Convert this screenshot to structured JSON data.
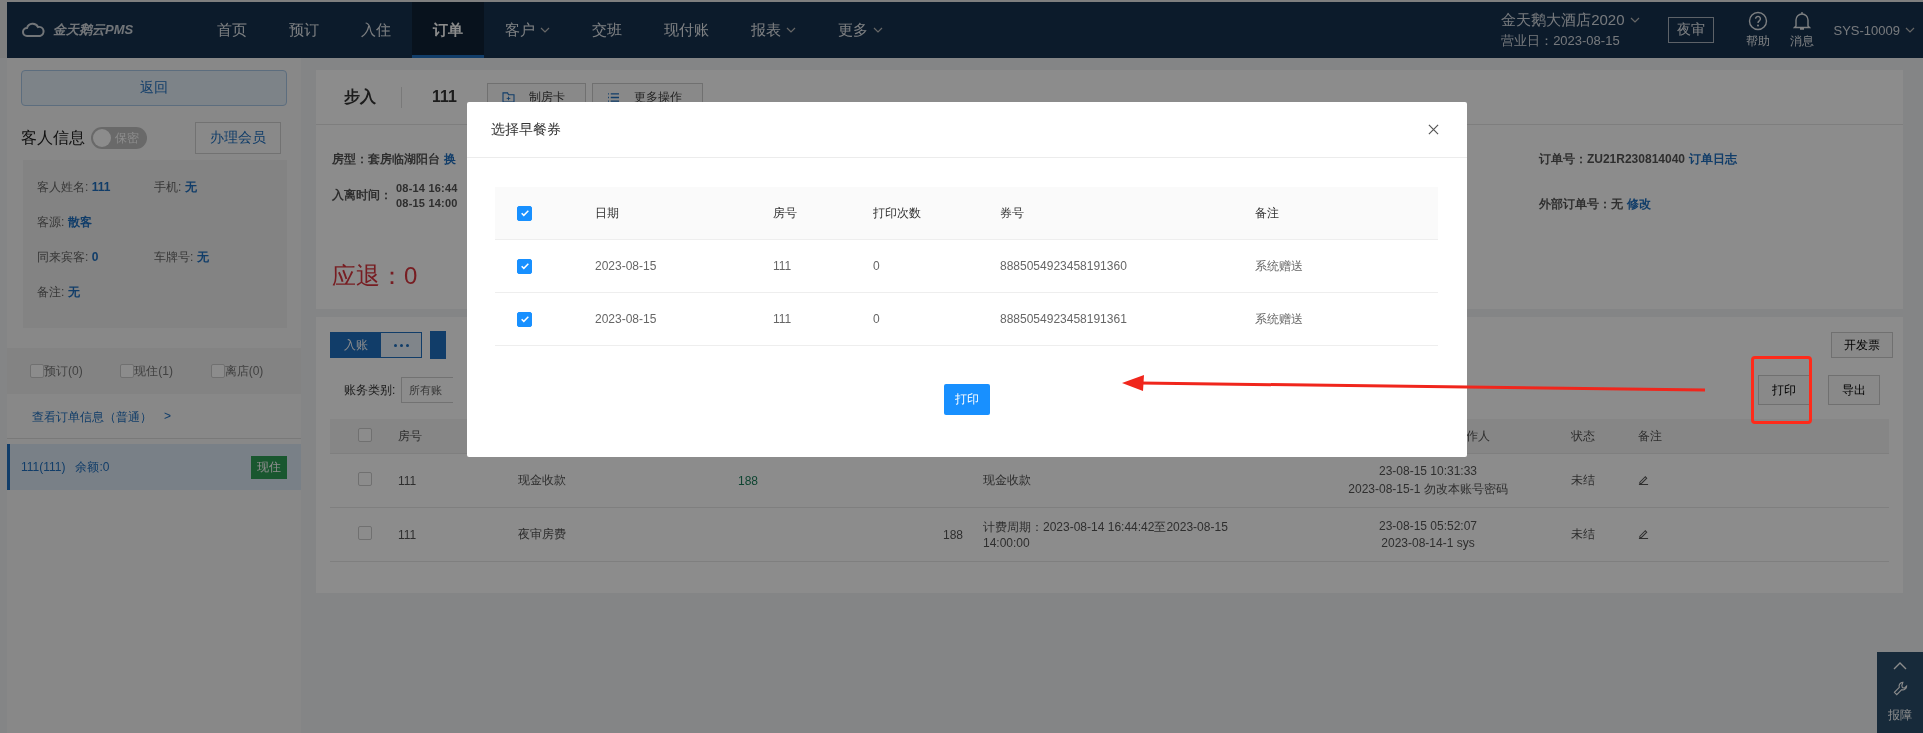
{
  "nav": {
    "logo": "金天鹅云PMS",
    "items": [
      {
        "label": "首页",
        "selected": false,
        "dropdown": false
      },
      {
        "label": "预订",
        "selected": false,
        "dropdown": false
      },
      {
        "label": "入住",
        "selected": false,
        "dropdown": false
      },
      {
        "label": "订单",
        "selected": true,
        "dropdown": false
      },
      {
        "label": "客户",
        "selected": false,
        "dropdown": true
      },
      {
        "label": "交班",
        "selected": false,
        "dropdown": false
      },
      {
        "label": "现付账",
        "selected": false,
        "dropdown": false
      },
      {
        "label": "报表",
        "selected": false,
        "dropdown": true
      },
      {
        "label": "更多",
        "selected": false,
        "dropdown": true
      }
    ],
    "hotel": "金天鹅大酒店2020",
    "business_date": "营业日：2023-08-15",
    "night_audit": "夜审",
    "help": "帮助",
    "messages": "消息",
    "user": "SYS-10009"
  },
  "sidebar": {
    "back": "返回",
    "guest_title": "客人信息",
    "privacy_toggle": {
      "label": "保密",
      "on": false
    },
    "member_button": "办理会员",
    "guest_rows": [
      [
        {
          "label": "客人姓名:",
          "value": "111"
        },
        {
          "label": "手机:",
          "value": "无"
        }
      ],
      [
        {
          "label": "客源:",
          "value": "散客"
        }
      ],
      [
        {
          "label": "同来宾客:",
          "value": "0"
        },
        {
          "label": "车牌号:",
          "value": "无"
        }
      ],
      [
        {
          "label": "备注:",
          "value": "无"
        }
      ]
    ],
    "filters": [
      {
        "label": "预订(0)",
        "checked": false
      },
      {
        "label": "现住(1)",
        "checked": false
      },
      {
        "label": "离店(0)",
        "checked": false
      }
    ],
    "order_link": "查看订单信息（普通）",
    "order_link_arrow": ">",
    "rooms": [
      {
        "name": "111(111)",
        "balance": "余额:0",
        "status": "现住",
        "selected": true
      }
    ]
  },
  "order": {
    "type": "步入",
    "room": "111",
    "actions": [
      "制房卡",
      "更多操作"
    ],
    "room_type": {
      "label": "房型：",
      "value": "套房临湖阳台",
      "link": "换"
    },
    "stay": {
      "label": "入离时间：",
      "arrive": "08-14 16:44",
      "depart": "08-15 14:00"
    },
    "order_no": {
      "label": "订单号：",
      "value": "ZU21R230814040",
      "link": "订单日志"
    },
    "external_no": {
      "label": "外部订单号：",
      "value": "无",
      "link": "修改"
    },
    "refund": "应退：0"
  },
  "bills": {
    "post_button": "入账",
    "invoice_button": "开发票",
    "category_label": "账务类别:",
    "category_value": "所有账",
    "print_button": "打印",
    "export_button": "导出",
    "select_all": false,
    "header": {
      "room": "房号",
      "operator": "作人",
      "status": "状态",
      "note": "备注"
    },
    "rows": [
      {
        "checked": false,
        "room": "111",
        "item": "现金收款",
        "payment": "188",
        "description": "现金收款",
        "time": "23-08-15 10:31:33",
        "operator": "2023-08-15-1 勿改本账号密码",
        "status": "未结"
      },
      {
        "checked": false,
        "room": "111",
        "item": "夜审房费",
        "charge": "188",
        "description": "计费周期：2023-08-14 16:44:42至2023-08-15 14:00:00",
        "time": "23-08-15 05:52:07",
        "operator": "2023-08-14-1 sys",
        "status": "未结"
      }
    ]
  },
  "dialog": {
    "title": "选择早餐券",
    "select_all": true,
    "columns": [
      "日期",
      "房号",
      "打印次数",
      "券号",
      "备注"
    ],
    "rows": [
      {
        "selected": true,
        "date": "2023-08-15",
        "room": "111",
        "print_count": "0",
        "code": "8885054923458191360",
        "note": "系统赠送"
      },
      {
        "selected": true,
        "date": "2023-08-15",
        "room": "111",
        "print_count": "0",
        "code": "8885054923458191361",
        "note": "系统赠送"
      }
    ],
    "print_button": "打印"
  },
  "report_widget": "报障"
}
